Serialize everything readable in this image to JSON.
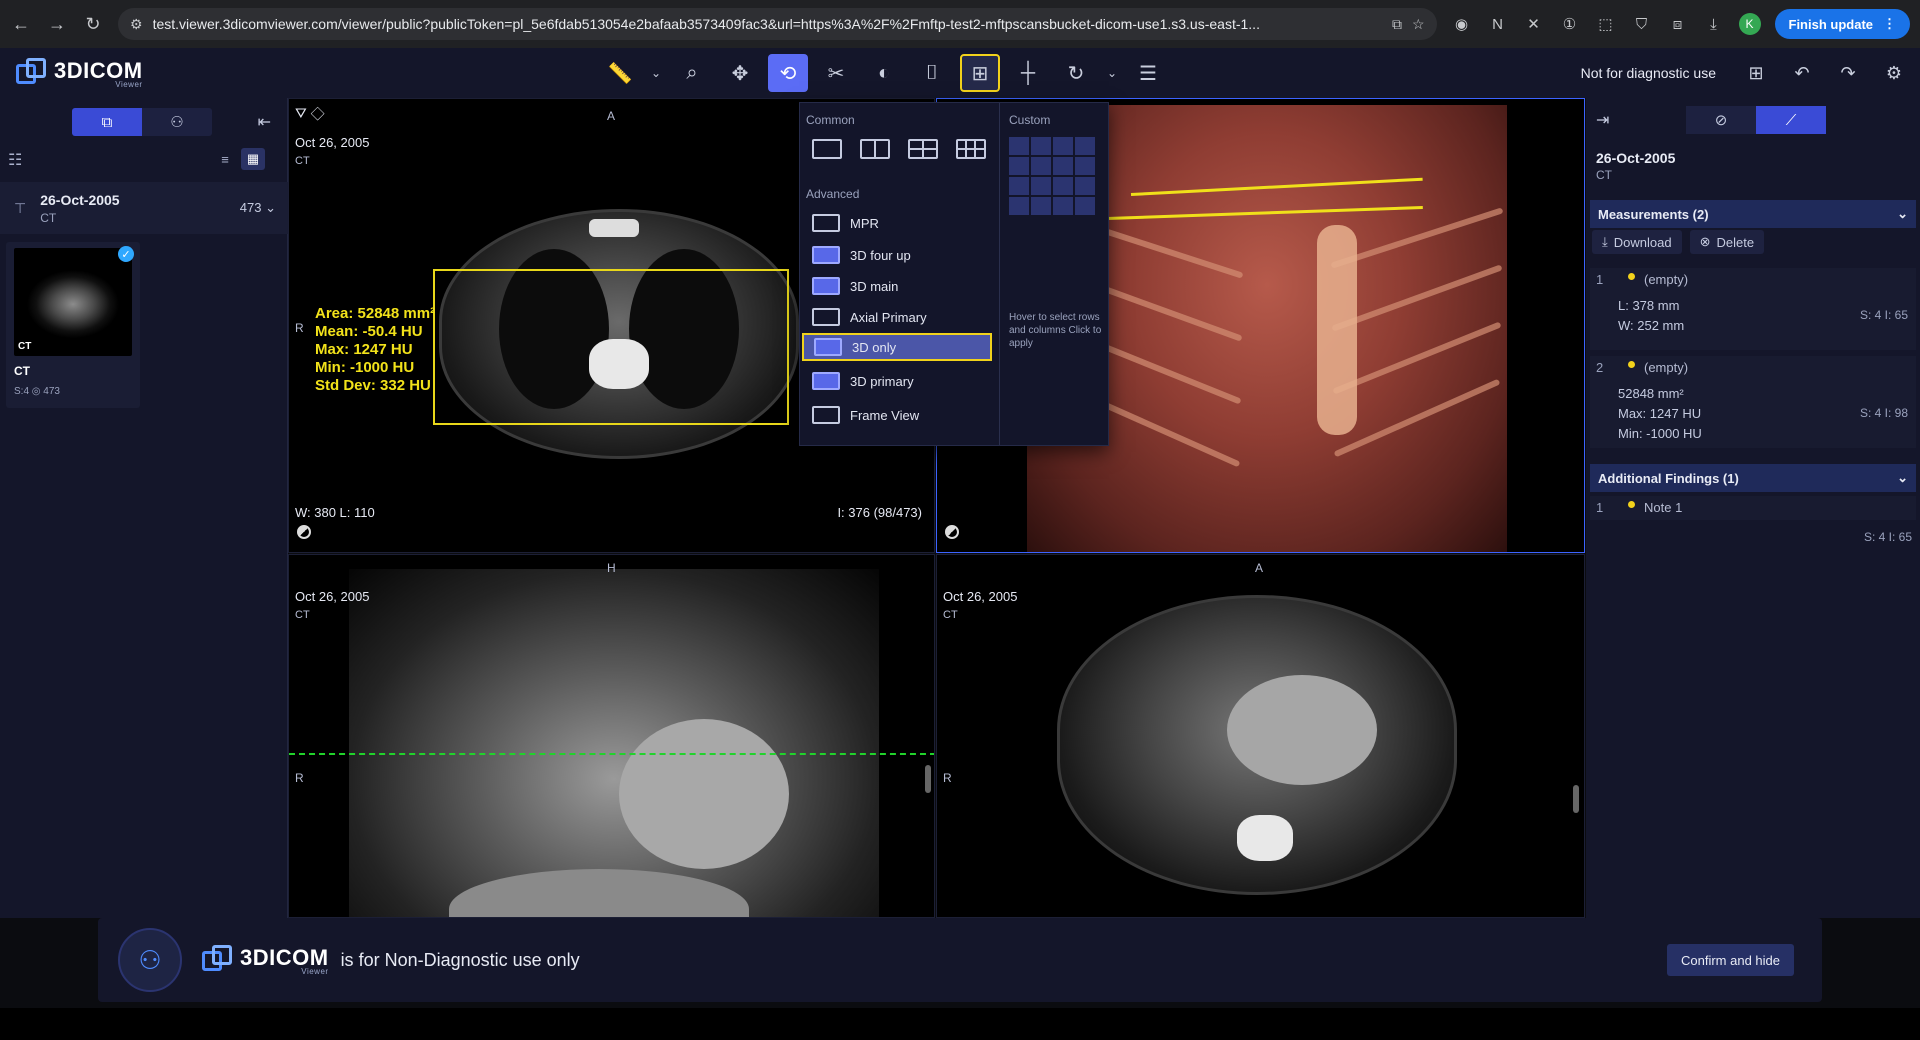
{
  "browser": {
    "url": "test.viewer.3dicomviewer.com/viewer/public?publicToken=pl_5e6fdab513054e2bafaab3573409fac3&url=https%3A%2F%2Fmftp-test2-mftpscansbucket-dicom-use1.s3.us-east-1...",
    "update_label": "Finish update",
    "avatar_letter": "K"
  },
  "app": {
    "logo_text": "3DICOM",
    "logo_sub": "Viewer",
    "notice": "Not for diagnostic use"
  },
  "left_panel": {
    "study_date": "26-Oct-2005",
    "study_modality": "CT",
    "study_count": "473",
    "series_tag": "CT",
    "series_label": "CT",
    "series_meta": "S:4   ◎ 473"
  },
  "viewports": {
    "tl": {
      "date": "Oct 26, 2005",
      "modality": "CT",
      "orient_top": "A",
      "orient_left": "R",
      "wl": "W: 380   L: 110",
      "slice": "I: 376 (98/473)",
      "roi": {
        "area": "Area: 52848 mm²",
        "mean": "Mean: -50.4 HU",
        "max": "Max: 1247 HU",
        "min": "Min: -1000 HU",
        "std": "Std Dev: 332 HU"
      }
    },
    "bl": {
      "date": "Oct 26, 2005",
      "modality": "CT",
      "orient_top": "H",
      "orient_left": "R"
    },
    "br": {
      "date": "Oct 26, 2005",
      "modality": "CT",
      "orient_top": "A",
      "orient_left": "R"
    }
  },
  "layout_menu": {
    "common_label": "Common",
    "advanced_label": "Advanced",
    "custom_label": "Custom",
    "items": [
      "MPR",
      "3D four up",
      "3D main",
      "Axial Primary",
      "3D only",
      "3D primary",
      "Frame View"
    ],
    "selected": "3D only",
    "custom_hint": "Hover to select rows and columns Click to apply"
  },
  "right_panel": {
    "date": "26-Oct-2005",
    "modality": "CT",
    "measurements_title": "Measurements (2)",
    "download_label": "Download",
    "delete_label": "Delete",
    "m1": {
      "num": "1",
      "label": "(empty)",
      "l": "L: 378 mm",
      "w": "W: 252 mm",
      "slice": "S: 4 I: 65"
    },
    "m2": {
      "num": "2",
      "label": "(empty)",
      "area": "52848 mm²",
      "max": "Max: 1247 HU",
      "min": "Min: -1000 HU",
      "slice": "S: 4 I: 98"
    },
    "findings_title": "Additional Findings (1)",
    "f1": {
      "num": "1",
      "label": "Note 1",
      "slice": "S: 4 I: 65"
    }
  },
  "banner": {
    "logo_text": "3DICOM",
    "logo_sub": "Viewer",
    "text": "is for Non-Diagnostic use only",
    "button": "Confirm and hide"
  },
  "colors": {
    "accent": "#3a4bd6",
    "highlight": "#f2d21b",
    "measurement": "#e8d71a"
  }
}
